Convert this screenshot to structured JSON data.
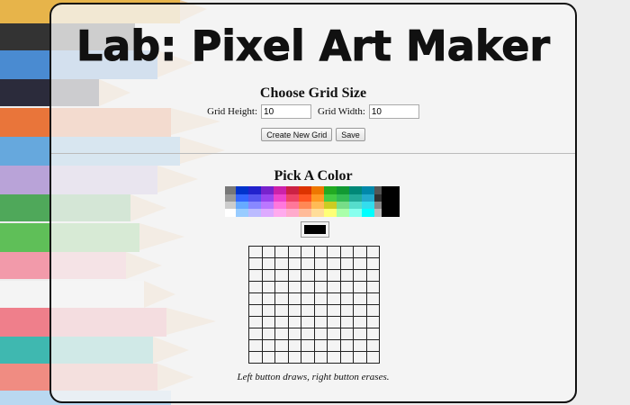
{
  "app": {
    "title": "Lab: Pixel Art Maker"
  },
  "grid_size": {
    "heading": "Choose Grid Size",
    "height_label": "Grid Height:",
    "height_value": "10",
    "width_label": "Grid Width:",
    "width_value": "10",
    "create_button": "Create New Grid",
    "save_button": "Save"
  },
  "color": {
    "heading": "Pick A Color",
    "selected": "#000000"
  },
  "grid": {
    "rows": 10,
    "cols": 10
  },
  "footer": {
    "hint": "Left button draws, right button erases."
  }
}
